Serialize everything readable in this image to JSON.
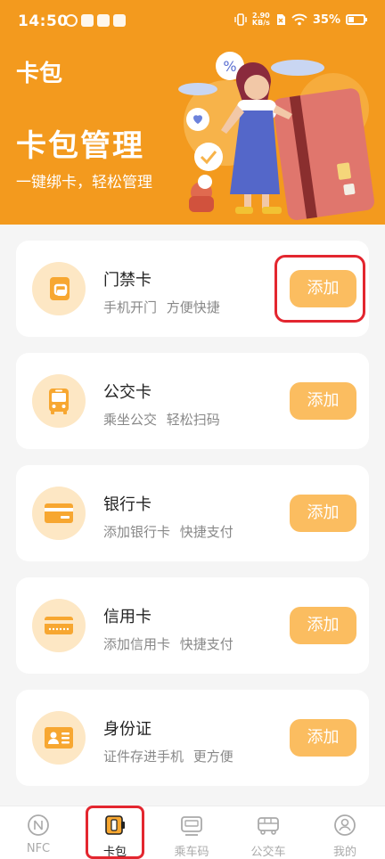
{
  "status": {
    "time": "14:50",
    "speed_top": "2.90",
    "speed_bottom": "KB/s",
    "battery": "35%",
    "battery_level": 0.35
  },
  "header": {
    "title": "卡包",
    "heading": "卡包管理",
    "subtitle": "一键绑卡，轻松管理"
  },
  "cards": [
    {
      "icon": "door-card-icon",
      "title": "门禁卡",
      "desc": "手机开门  方便快捷",
      "button": "添加"
    },
    {
      "icon": "bus-icon",
      "title": "公交卡",
      "desc": "乘坐公交  轻松扫码",
      "button": "添加"
    },
    {
      "icon": "bank-card-icon",
      "title": "银行卡",
      "desc": "添加银行卡  快捷支付",
      "button": "添加"
    },
    {
      "icon": "credit-card-icon",
      "title": "信用卡",
      "desc": "添加信用卡  快捷支付",
      "button": "添加"
    },
    {
      "icon": "id-card-icon",
      "title": "身份证",
      "desc": "证件存进手机  更方便",
      "button": "添加"
    }
  ],
  "tabs": [
    {
      "icon": "nfc-icon",
      "label": "NFC"
    },
    {
      "icon": "wallet-icon",
      "label": "卡包"
    },
    {
      "icon": "ride-code-icon",
      "label": "乘车码"
    },
    {
      "icon": "bus-tab-icon",
      "label": "公交车"
    },
    {
      "icon": "profile-icon",
      "label": "我的"
    }
  ],
  "active_tab": 1,
  "colors": {
    "header": "#f39a1e",
    "accent": "#fbbd60",
    "icon_bg": "#fde7c4",
    "highlight": "#e3262f"
  }
}
